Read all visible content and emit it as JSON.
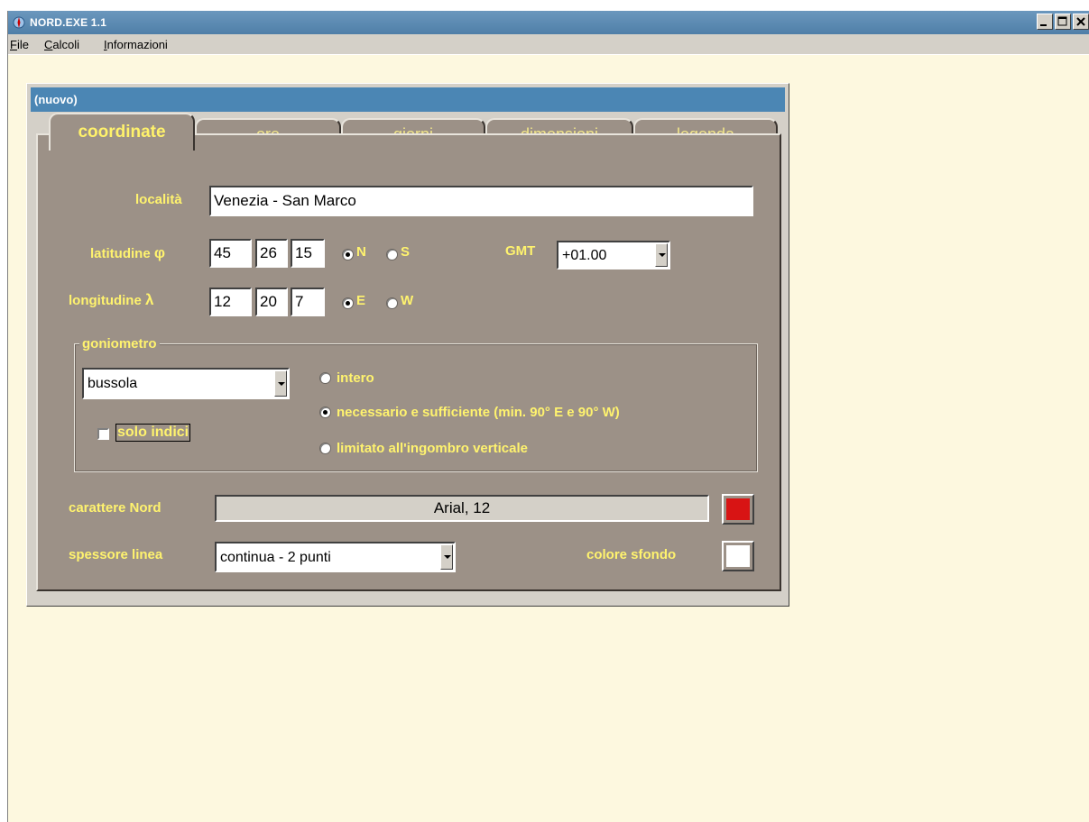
{
  "app": {
    "title": "NORD.EXE 1.1",
    "menu": [
      {
        "label": "File",
        "underline": "F",
        "rest": "ile"
      },
      {
        "label": "Calcoli",
        "underline": "C",
        "rest": "alcoli"
      },
      {
        "label": "Informazioni",
        "underline": "I",
        "rest": "nformazioni"
      }
    ]
  },
  "document": {
    "title": "(nuovo)"
  },
  "tabs": {
    "coordinate": "coordinate",
    "ore": "ore",
    "giorni": "giorni",
    "dimensioni": "dimensioni",
    "legenda": "legenda",
    "active": "coordinate"
  },
  "form": {
    "localita_label": "località",
    "localita_value": "Venezia - San Marco",
    "latitudine_label": "latitudine",
    "latitudine_symbol": "φ",
    "lat_deg": "45",
    "lat_min": "26",
    "lat_sec": "15",
    "lat_n": "N",
    "lat_s": "S",
    "lat_selected": "N",
    "gmt_label": "GMT",
    "gmt_value": "+01.00",
    "longitudine_label": "longitudine",
    "longitudine_symbol": "λ",
    "lon_deg": "12",
    "lon_min": "20",
    "lon_sec": "7",
    "lon_e": "E",
    "lon_w": "W",
    "lon_selected": "E",
    "goniometro_label": "goniometro",
    "goniometro_value": "bussola",
    "solo_indici_label": "solo indici",
    "solo_indici_checked": false,
    "option_intero": "intero",
    "option_necessario": "necessario e sufficiente (min. 90° E e 90° W)",
    "option_limitato": "limitato all'ingombro verticale",
    "goniometro_selected": "necessario",
    "carattere_label": "carattere Nord",
    "carattere_value": "Arial, 12",
    "carattere_color": "#d81414",
    "spessore_label": "spessore linea",
    "spessore_value": "continua - 2 punti",
    "colore_sfondo_label": "colore sfondo",
    "colore_sfondo_color": "#ffffff"
  },
  "colors": {
    "label_yellow": "#fff36e",
    "panel": "#9c9187",
    "workspace": "#fdf8df",
    "titlebar": "#4b86b4"
  }
}
